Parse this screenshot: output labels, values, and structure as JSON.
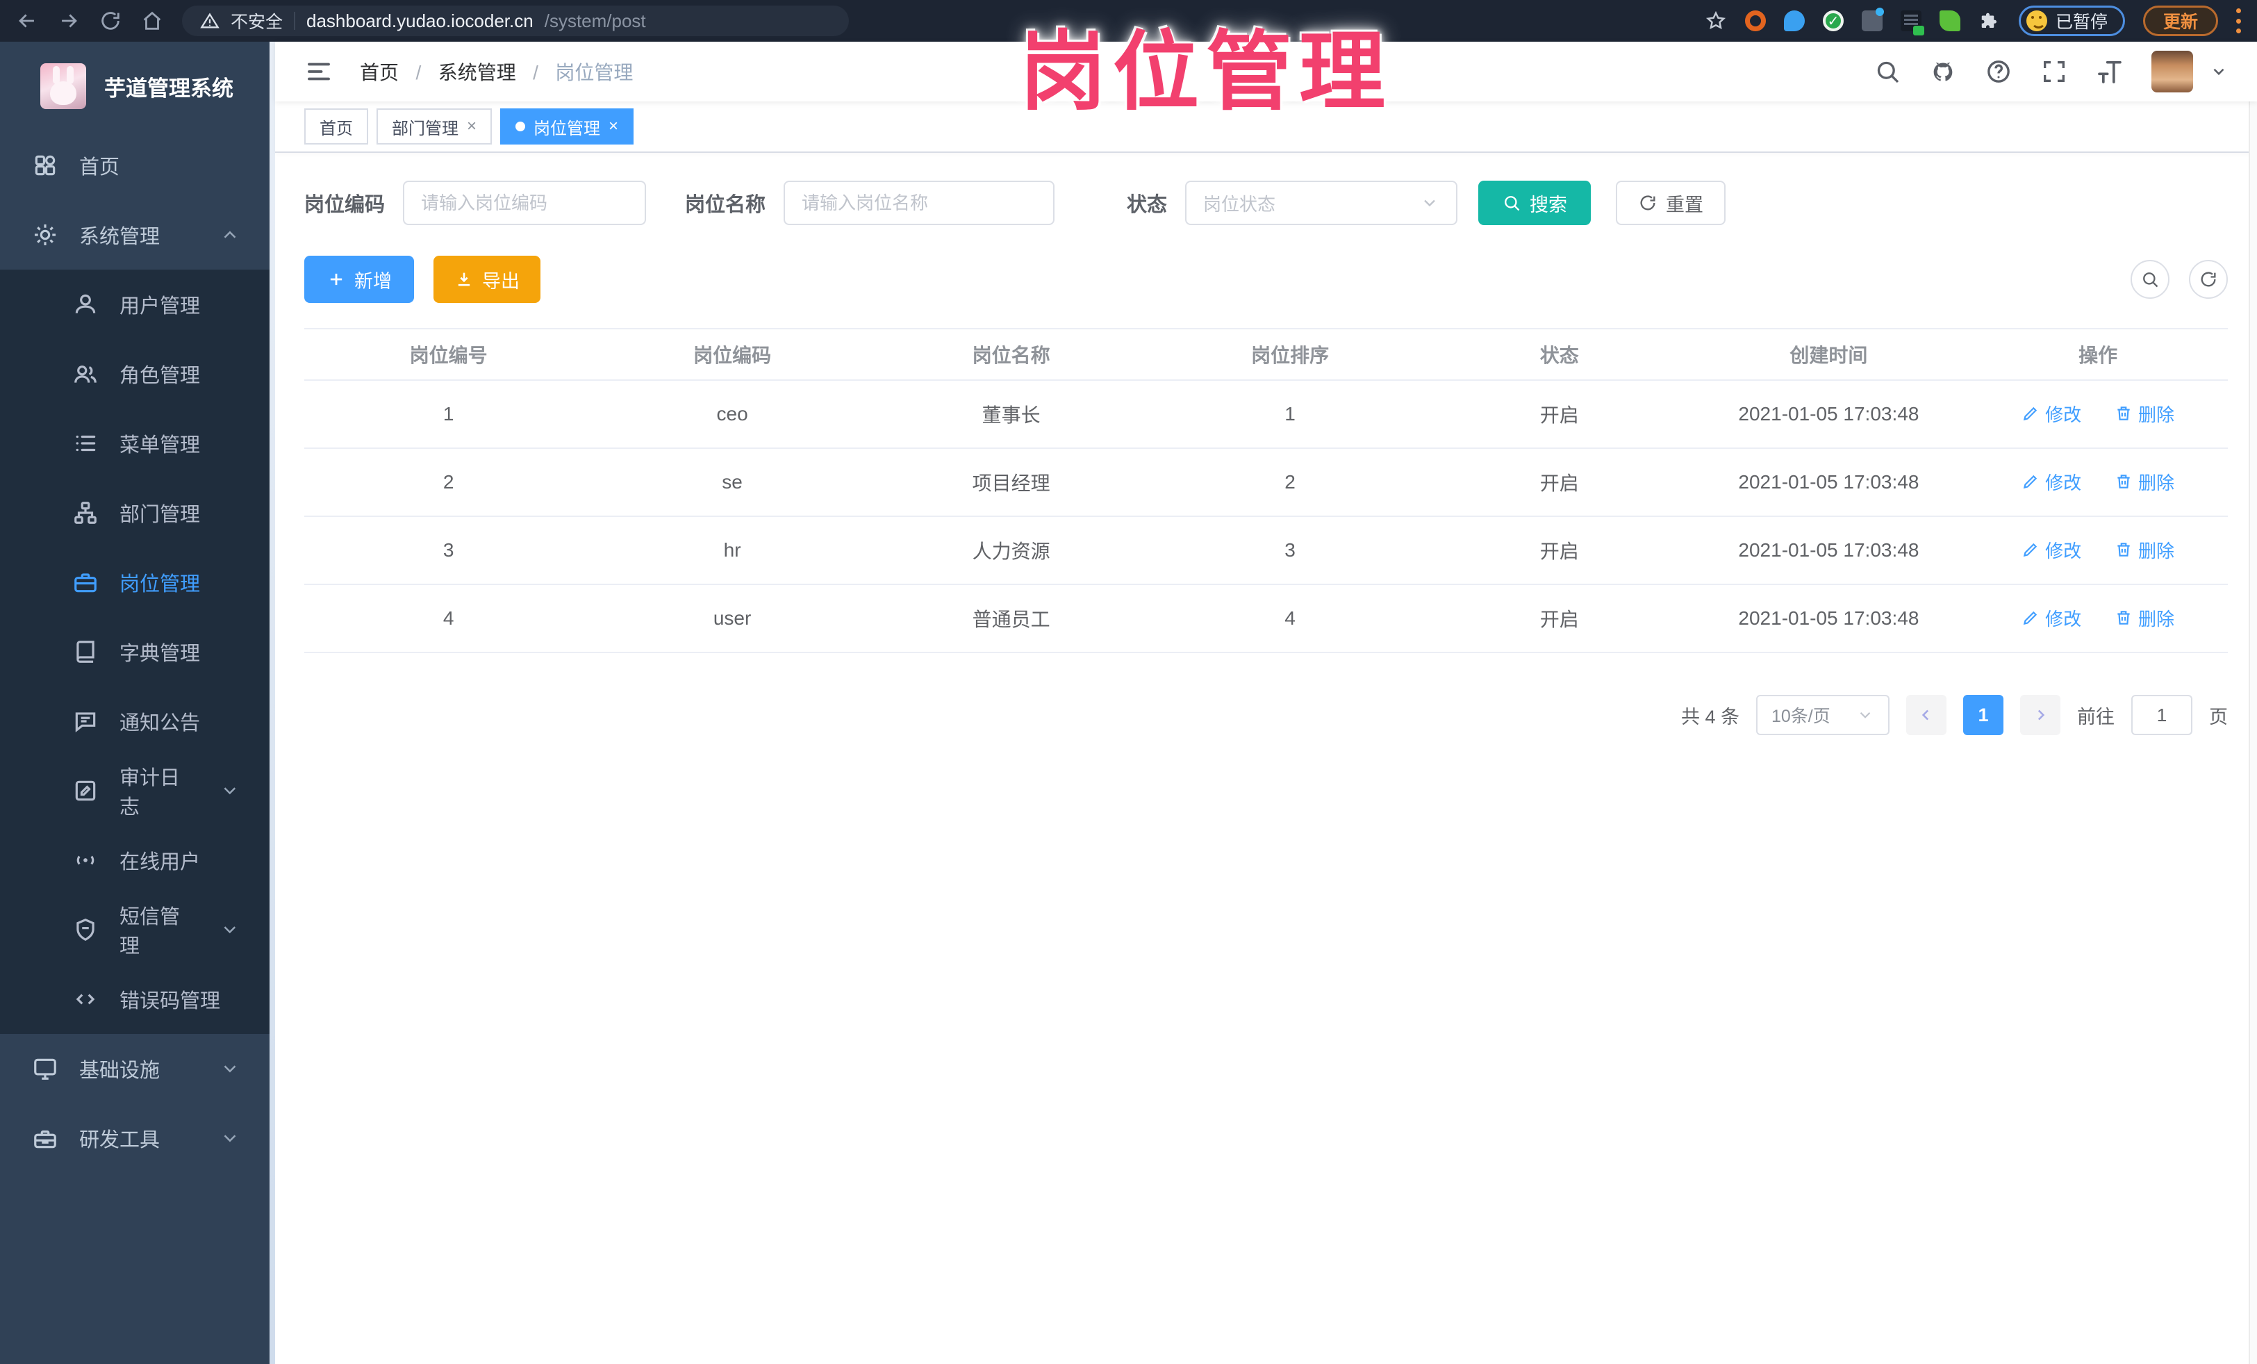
{
  "browser": {
    "security_label": "不安全",
    "url_host": "dashboard.yudao.iocoder.cn",
    "url_path": "/system/post",
    "paused_label": "已暂停",
    "update_label": "更新"
  },
  "annotation": {
    "text": "岗位管理"
  },
  "sidebar": {
    "app_title": "芋道管理系统",
    "home": "首页",
    "system": "系统管理",
    "submenu": [
      "用户管理",
      "角色管理",
      "菜单管理",
      "部门管理",
      "岗位管理",
      "字典管理",
      "通知公告",
      "审计日志",
      "在线用户",
      "短信管理",
      "错误码管理"
    ],
    "infra": "基础设施",
    "devtools": "研发工具"
  },
  "breadcrumb": {
    "items": [
      "首页",
      "系统管理",
      "岗位管理"
    ],
    "separator": "/"
  },
  "tabs": [
    {
      "label": "首页"
    },
    {
      "label": "部门管理",
      "close": "×"
    },
    {
      "label": "岗位管理",
      "close": "×"
    }
  ],
  "filters": {
    "post_code_label": "岗位编码",
    "post_code_placeholder": "请输入岗位编码",
    "post_name_label": "岗位名称",
    "post_name_placeholder": "请输入岗位名称",
    "status_label": "状态",
    "status_placeholder": "岗位状态",
    "search_label": "搜索",
    "reset_label": "重置"
  },
  "toolbar": {
    "add_label": "新增",
    "export_label": "导出"
  },
  "table": {
    "columns": [
      "岗位编号",
      "岗位编码",
      "岗位名称",
      "岗位排序",
      "状态",
      "创建时间",
      "操作"
    ],
    "edit_label": "修改",
    "delete_label": "删除",
    "rows": [
      {
        "id": "1",
        "code": "ceo",
        "name": "董事长",
        "sort": "1",
        "status": "开启",
        "created": "2021-01-05 17:03:48"
      },
      {
        "id": "2",
        "code": "se",
        "name": "项目经理",
        "sort": "2",
        "status": "开启",
        "created": "2021-01-05 17:03:48"
      },
      {
        "id": "3",
        "code": "hr",
        "name": "人力资源",
        "sort": "3",
        "status": "开启",
        "created": "2021-01-05 17:03:48"
      },
      {
        "id": "4",
        "code": "user",
        "name": "普通员工",
        "sort": "4",
        "status": "开启",
        "created": "2021-01-05 17:03:48"
      }
    ]
  },
  "pagination": {
    "total": "共 4 条",
    "page_size": "10条/页",
    "current": "1",
    "goto_label": "前往",
    "goto_value": "1",
    "page_unit": "页"
  },
  "colors": {
    "accent": "#409eff",
    "search_button": "#15b8a6",
    "export_button": "#f5a40b",
    "sidebar_bg": "#304156",
    "submenu_bg": "#1f2d3d",
    "annotation": "#f2406e"
  }
}
